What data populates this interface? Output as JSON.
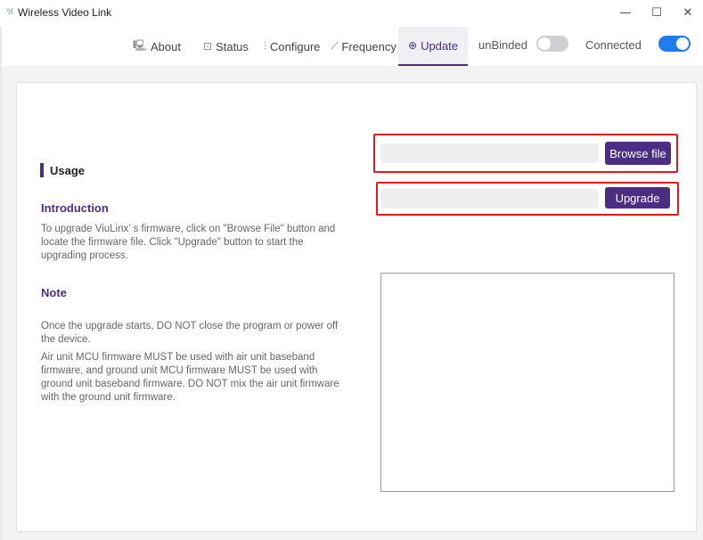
{
  "window": {
    "icon": "ᵛ⁄ₗ",
    "title": "Wireless Video Link",
    "minimize_glyph": "—",
    "maximize_glyph": "☐",
    "close_glyph": "✕"
  },
  "nav": {
    "tabs": [
      {
        "label": "About",
        "icon": "monitor-icon",
        "glyph": "🖳"
      },
      {
        "label": "Status",
        "icon": "status-icon",
        "glyph": "⊡"
      },
      {
        "label": "Configure",
        "icon": "sliders-icon",
        "glyph": "⫶"
      },
      {
        "label": "Frequency",
        "icon": "chart-icon",
        "glyph": "⟋"
      },
      {
        "label": "Update",
        "icon": "upload-icon",
        "glyph": "⊕",
        "active": true
      }
    ],
    "bind_label": "unBinded",
    "bind_state": "off",
    "connect_label": "Connected",
    "connect_state": "on",
    "accent": "#4b2e83",
    "toggle_on_color": "#1e7bf0"
  },
  "left": {
    "usage_title": "Usage",
    "intro_title": "Introduction",
    "intro_text": "To upgrade ViuLinx’ s firmware, click on  \"Browse File\" button and locate the firmware file. Click  \"Upgrade\"  button to start the upgrading process.",
    "note_title": "Note",
    "note_text_1": "Once the upgrade starts, DO NOT close the program or power off the device.",
    "note_text_2": "Air unit MCU firmware MUST be used with air unit baseband firmware, and ground unit MCU firmware MUST be used with ground unit baseband firmware. DO NOT mix the air unit firmware with the ground unit firmware."
  },
  "right": {
    "file_path_value": "",
    "browse_label": "Browse file",
    "progress_value": "",
    "upgrade_label": "Upgrade",
    "log_text": ""
  },
  "colors": {
    "highlight_frame": "#e01b1b"
  }
}
